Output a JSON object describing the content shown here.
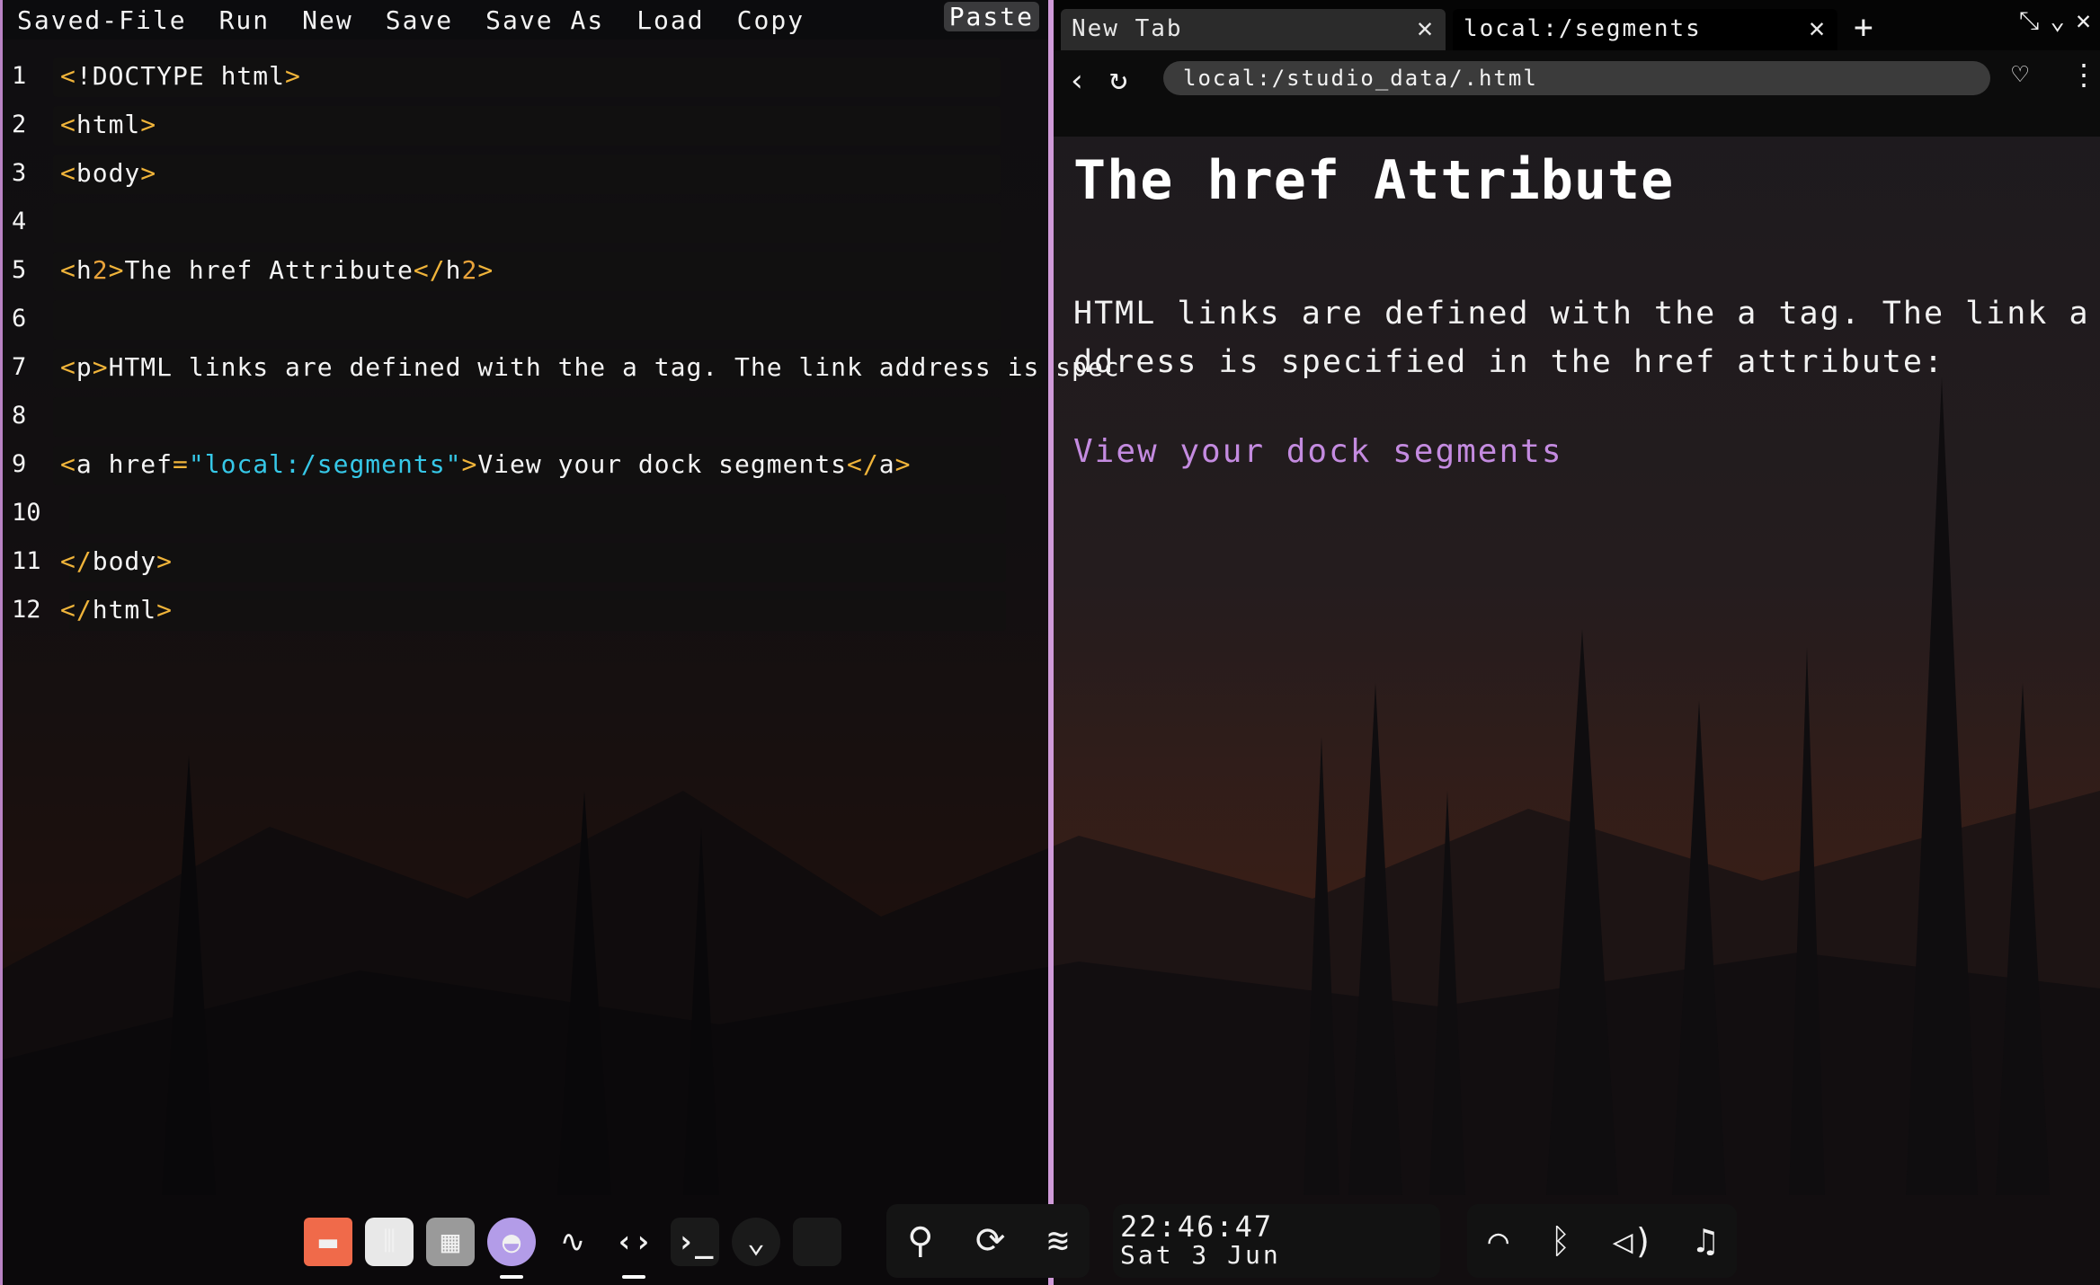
{
  "editor": {
    "menu": [
      "Saved-File",
      "Run",
      "New",
      "Save",
      "Save As",
      "Load",
      "Copy",
      "Paste"
    ],
    "lines": [
      {
        "n": "1",
        "segs": [
          [
            "tag",
            "<"
          ],
          [
            "txt",
            "!DOCTYPE html"
          ],
          [
            "tag",
            ">"
          ]
        ]
      },
      {
        "n": "2",
        "segs": [
          [
            "tag",
            "<"
          ],
          [
            "txt",
            "html"
          ],
          [
            "tag",
            ">"
          ]
        ]
      },
      {
        "n": "3",
        "segs": [
          [
            "tag",
            "<"
          ],
          [
            "txt",
            "body"
          ],
          [
            "tag",
            ">"
          ]
        ]
      },
      {
        "n": "4",
        "segs": []
      },
      {
        "n": "5",
        "segs": [
          [
            "tag",
            "<"
          ],
          [
            "txt",
            "h"
          ],
          [
            "num",
            "2"
          ],
          [
            "tag",
            ">"
          ],
          [
            "txt",
            "The href Attribute"
          ],
          [
            "tag",
            "</"
          ],
          [
            "txt",
            "h"
          ],
          [
            "num",
            "2"
          ],
          [
            "tag",
            ">"
          ]
        ]
      },
      {
        "n": "6",
        "segs": []
      },
      {
        "n": "7",
        "segs": [
          [
            "tag",
            "<"
          ],
          [
            "txt",
            "p"
          ],
          [
            "tag",
            ">"
          ],
          [
            "txt",
            "HTML links are defined with the a tag. The link address is spec"
          ]
        ]
      },
      {
        "n": "8",
        "segs": []
      },
      {
        "n": "9",
        "segs": [
          [
            "tag",
            "<"
          ],
          [
            "txt",
            "a href"
          ],
          [
            "tag",
            "="
          ],
          [
            "str",
            "\"local:/segments\""
          ],
          [
            "tag",
            ">"
          ],
          [
            "txt",
            "View your dock segments"
          ],
          [
            "tag",
            "</"
          ],
          [
            "txt",
            "a"
          ],
          [
            "tag",
            ">"
          ]
        ]
      },
      {
        "n": "10",
        "segs": []
      },
      {
        "n": "11",
        "segs": [
          [
            "txt",
            " "
          ],
          [
            "tag",
            "</"
          ],
          [
            "txt",
            "body"
          ],
          [
            "tag",
            ">"
          ]
        ]
      },
      {
        "n": "12",
        "segs": [
          [
            "txt",
            " "
          ],
          [
            "tag",
            "</"
          ],
          [
            "txt",
            "html"
          ],
          [
            "tag",
            ">"
          ]
        ]
      }
    ]
  },
  "browser": {
    "tabs": [
      {
        "label": "New Tab",
        "active": false
      },
      {
        "label": "local:/segments",
        "active": true
      }
    ],
    "new_tab": "+",
    "url": "local:/studio_data/.html",
    "page": {
      "heading": "The href Attribute",
      "paragraph": "HTML links are defined with the a tag. The link address is specified in the href attribute:",
      "link": "View your dock segments"
    }
  },
  "dock": {
    "apps": [
      "folder-icon",
      "mixer-icon",
      "calculator-icon",
      "ghost-icon",
      "activity-icon",
      "code-icon",
      "terminal-icon",
      "chevron-icon",
      "blank-app"
    ],
    "tools": [
      "search-icon",
      "sync-icon",
      "layers-icon"
    ],
    "clock": {
      "time": "22:46:47",
      "date": "Sat 3 Jun"
    },
    "status": [
      "wifi-icon",
      "bluetooth-icon",
      "volume-icon",
      "bell-icon"
    ]
  },
  "colors": {
    "tag": "#f0b43a",
    "string": "#36c8e8",
    "link": "#c48be0",
    "divider": "#cf9ad8"
  }
}
